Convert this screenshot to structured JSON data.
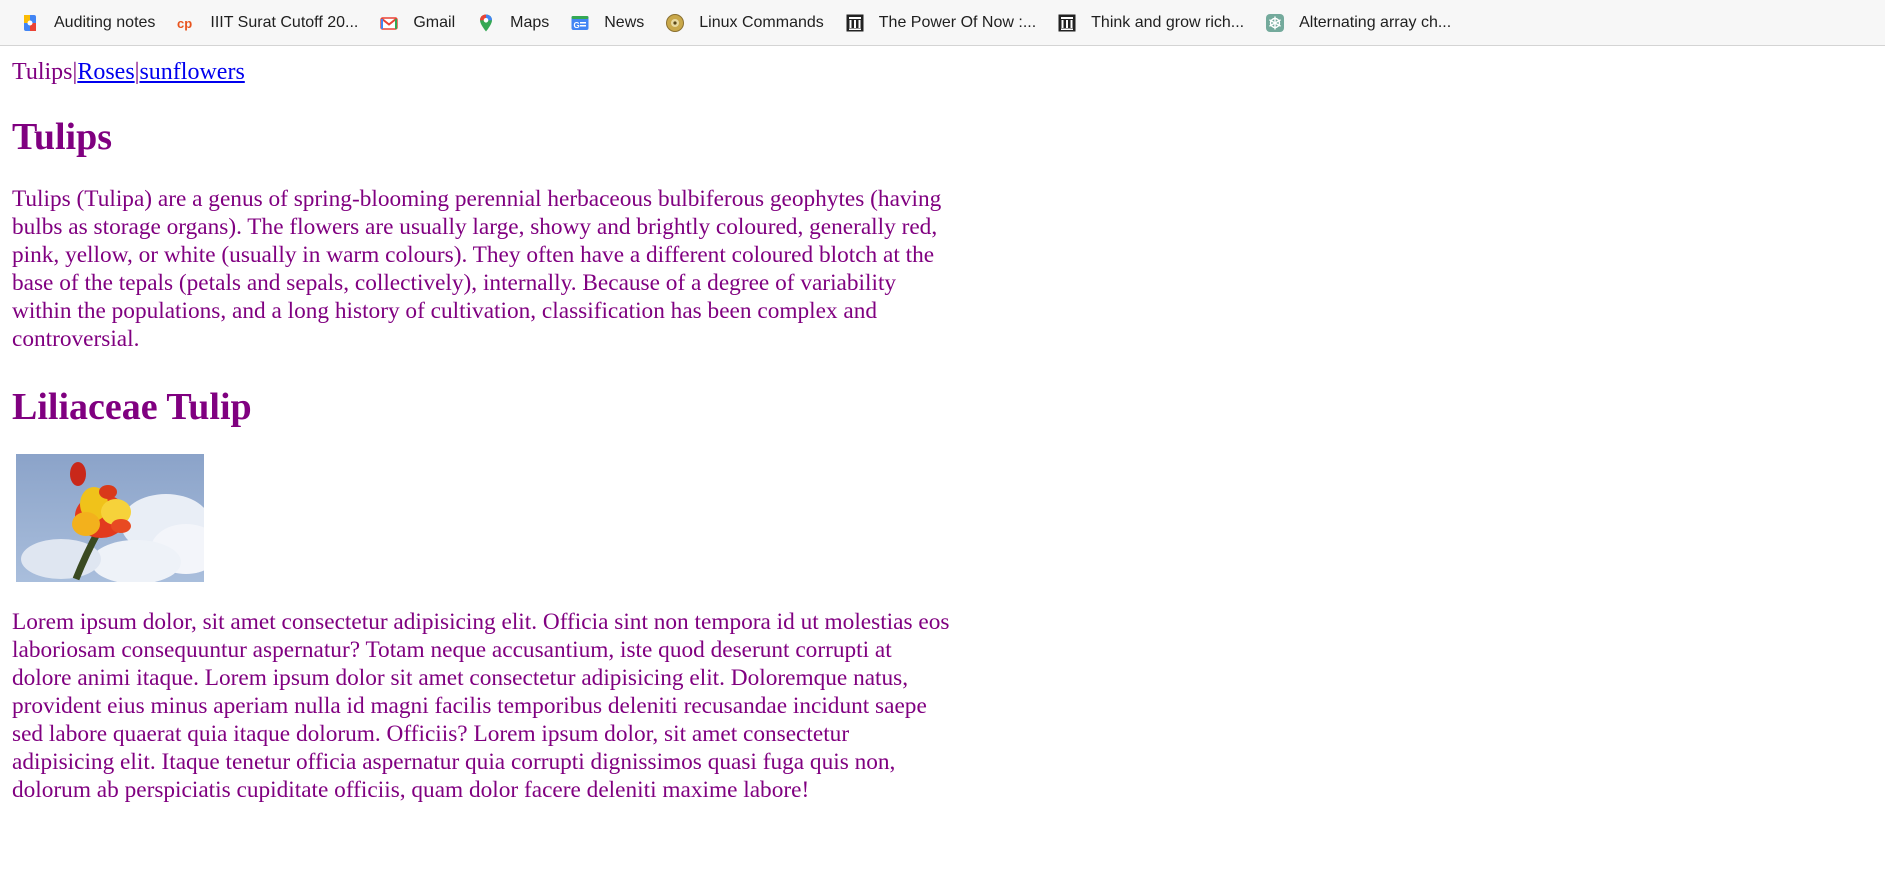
{
  "bookmarks": [
    {
      "label": "Auditing notes",
      "icon": "drive-icon"
    },
    {
      "label": "IIIT Surat Cutoff 20...",
      "icon": "cp-icon"
    },
    {
      "label": "Gmail",
      "icon": "gmail-icon"
    },
    {
      "label": "Maps",
      "icon": "maps-icon"
    },
    {
      "label": "News",
      "icon": "news-icon"
    },
    {
      "label": "Linux Commands",
      "icon": "disc-icon"
    },
    {
      "label": "The Power Of Now :...",
      "icon": "library-icon"
    },
    {
      "label": "Think and grow rich...",
      "icon": "library-icon"
    },
    {
      "label": "Alternating array ch...",
      "icon": "chatgpt-icon"
    }
  ],
  "nav": {
    "current": "Tulips",
    "separator": "|",
    "links": [
      "Roses",
      "sunflowers"
    ]
  },
  "content": {
    "heading1": "Tulips",
    "paragraph1": "Tulips (Tulipa) are a genus of spring-blooming perennial herbaceous bulbiferous geophytes (having bulbs as storage organs). The flowers are usually large, showy and brightly coloured, generally red, pink, yellow, or white (usually in warm colours). They often have a different coloured blotch at the base of the tepals (petals and sepals, collectively), internally. Because of a degree of variability within the populations, and a long history of cultivation, classification has been complex and controversial.",
    "heading2": "Liliaceae Tulip",
    "image": "tulip-photo",
    "paragraph2": "Lorem ipsum dolor, sit amet consectetur adipisicing elit. Officia sint non tempora id ut molestias eos laboriosam consequuntur aspernatur? Totam neque accusantium, iste quod deserunt corrupti at dolore animi itaque. Lorem ipsum dolor sit amet consectetur adipisicing elit. Doloremque natus, provident eius minus aperiam nulla id magni facilis temporibus deleniti recusandae incidunt saepe sed labore quaerat quia itaque dolorum. Officiis? Lorem ipsum dolor, sit amet consectetur adipisicing elit. Itaque tenetur officia aspernatur quia corrupti dignissimos quasi fuga quis non, dolorum ab perspiciatis cupiditate officiis, quam dolor facere deleniti maxime labore!"
  },
  "colors": {
    "text": "#800080",
    "link": "#0000ee",
    "bookmark_bar": "#f7f7f7"
  }
}
